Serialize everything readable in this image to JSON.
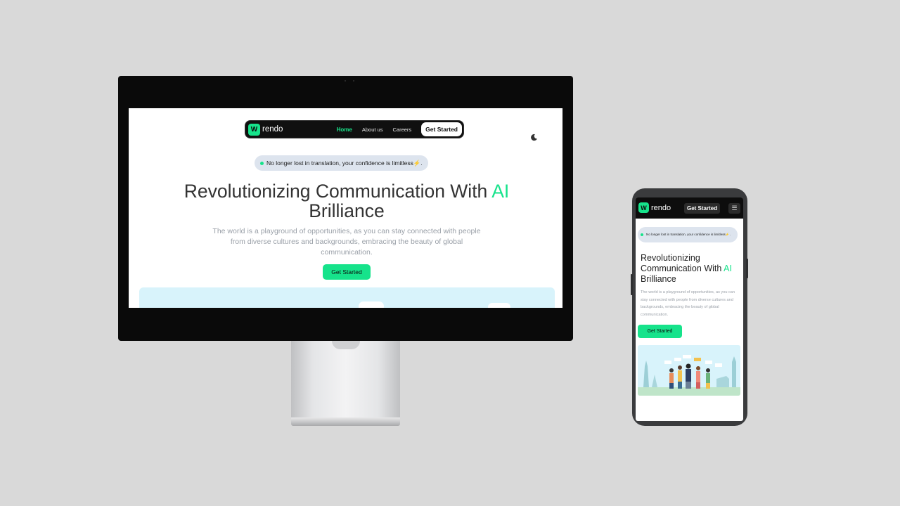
{
  "brand": {
    "name": "rendo",
    "logo_glyph": "W",
    "accent": "#16e38b"
  },
  "desktop": {
    "nav": {
      "items": [
        {
          "label": "Home",
          "active": true
        },
        {
          "label": "About us",
          "active": false
        },
        {
          "label": "Careers",
          "active": false
        }
      ],
      "cta": "Get Started"
    },
    "theme_toggle_icon": "moon-icon",
    "badge": "No longer lost in translation, your confidence is limitless⚡.",
    "title_main": "Revolutionizing Communication With ",
    "title_ai": "AI",
    "title_end": "Brilliance",
    "subtitle": "The world is a playground of opportunities, as you can stay connected with people from diverse cultures and backgrounds, embracing the beauty of global communication.",
    "button": "Get Started"
  },
  "mobile": {
    "nav": {
      "cta": "Get Started",
      "menu_icon": "hamburger-menu-icon",
      "menu_glyph": "☰"
    },
    "badge": "No longer lost in translation, your confidence is limitless⚡.",
    "title_main": "Revolutionizing Communication With ",
    "title_ai": "AI",
    "title_end": "Brilliance",
    "subtitle": "The world is a playground of opportunities, as you can stay connected with people from diverse cultures and backgrounds, embracing the beauty of global communication.",
    "button": "Get Started"
  }
}
